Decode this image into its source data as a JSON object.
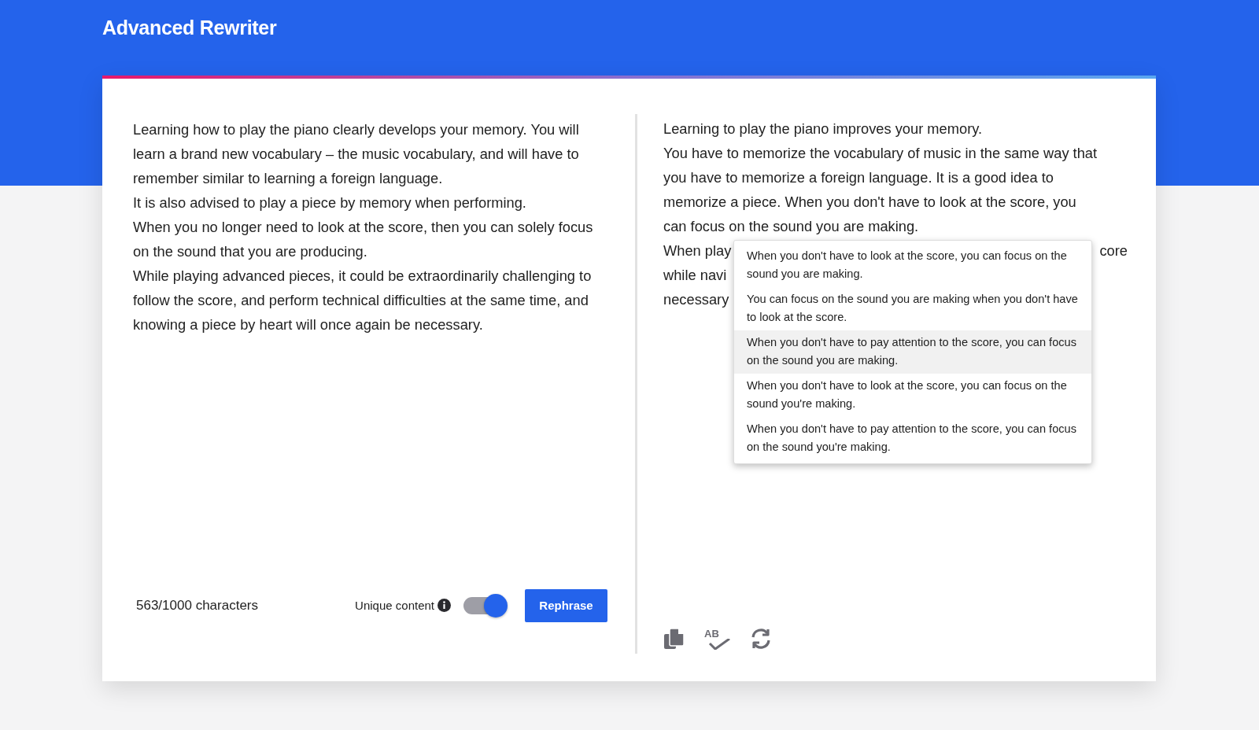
{
  "app": {
    "title": "Advanced Rewriter"
  },
  "input": {
    "paragraphs": [
      "Learning how to play the piano clearly develops your memory. You will learn a brand new vocabulary – the music vocabulary, and will have to remember similar to learning a foreign language.",
      "It is also advised to play a piece by memory when performing.",
      "When you no longer need to look at the score, then you can solely focus on the sound that you are producing.",
      "While playing advanced pieces, it could be extraordinarily challenging to follow the score, and perform technical difficulties at the same time, and knowing a piece by heart will once again be necessary."
    ],
    "char_count": "563/1000 characters"
  },
  "unique_content": {
    "label": "Unique content",
    "on": true
  },
  "rephrase_button": "Rephrase",
  "output": {
    "lines": [
      {
        "text": "Learning to play the piano improves your memory."
      },
      {
        "text": "You have to memorize the vocabulary of music in the same way that"
      },
      {
        "text": "you have to memorize a foreign language. It is a good idea to"
      },
      {
        "text": "memorize a piece. When you don't have to look at the score, you"
      },
      {
        "text": "can focus on the sound you are making."
      },
      {
        "text": "When play",
        "tail": "core"
      },
      {
        "text": "while navi"
      },
      {
        "text": "necessary"
      }
    ]
  },
  "toolbar": [
    {
      "kind": "copy"
    },
    {
      "kind": "spellcheck",
      "label": "AB"
    },
    {
      "kind": "refresh"
    }
  ],
  "suggestions": [
    {
      "text": "When you don't have to look at the score, you can focus on the sound you are making.",
      "selected": false
    },
    {
      "text": "You can focus on the sound you are making when you don't have to look at the score.",
      "selected": false
    },
    {
      "text": "When you don't have to pay attention to the score, you can focus on the sound you are making.",
      "selected": true
    },
    {
      "text": "When you don't have to look at the score, you can focus on the sound you're making.",
      "selected": false
    },
    {
      "text": "When you don't have to pay attention to the score, you can focus on the sound you're making.",
      "selected": false
    }
  ]
}
